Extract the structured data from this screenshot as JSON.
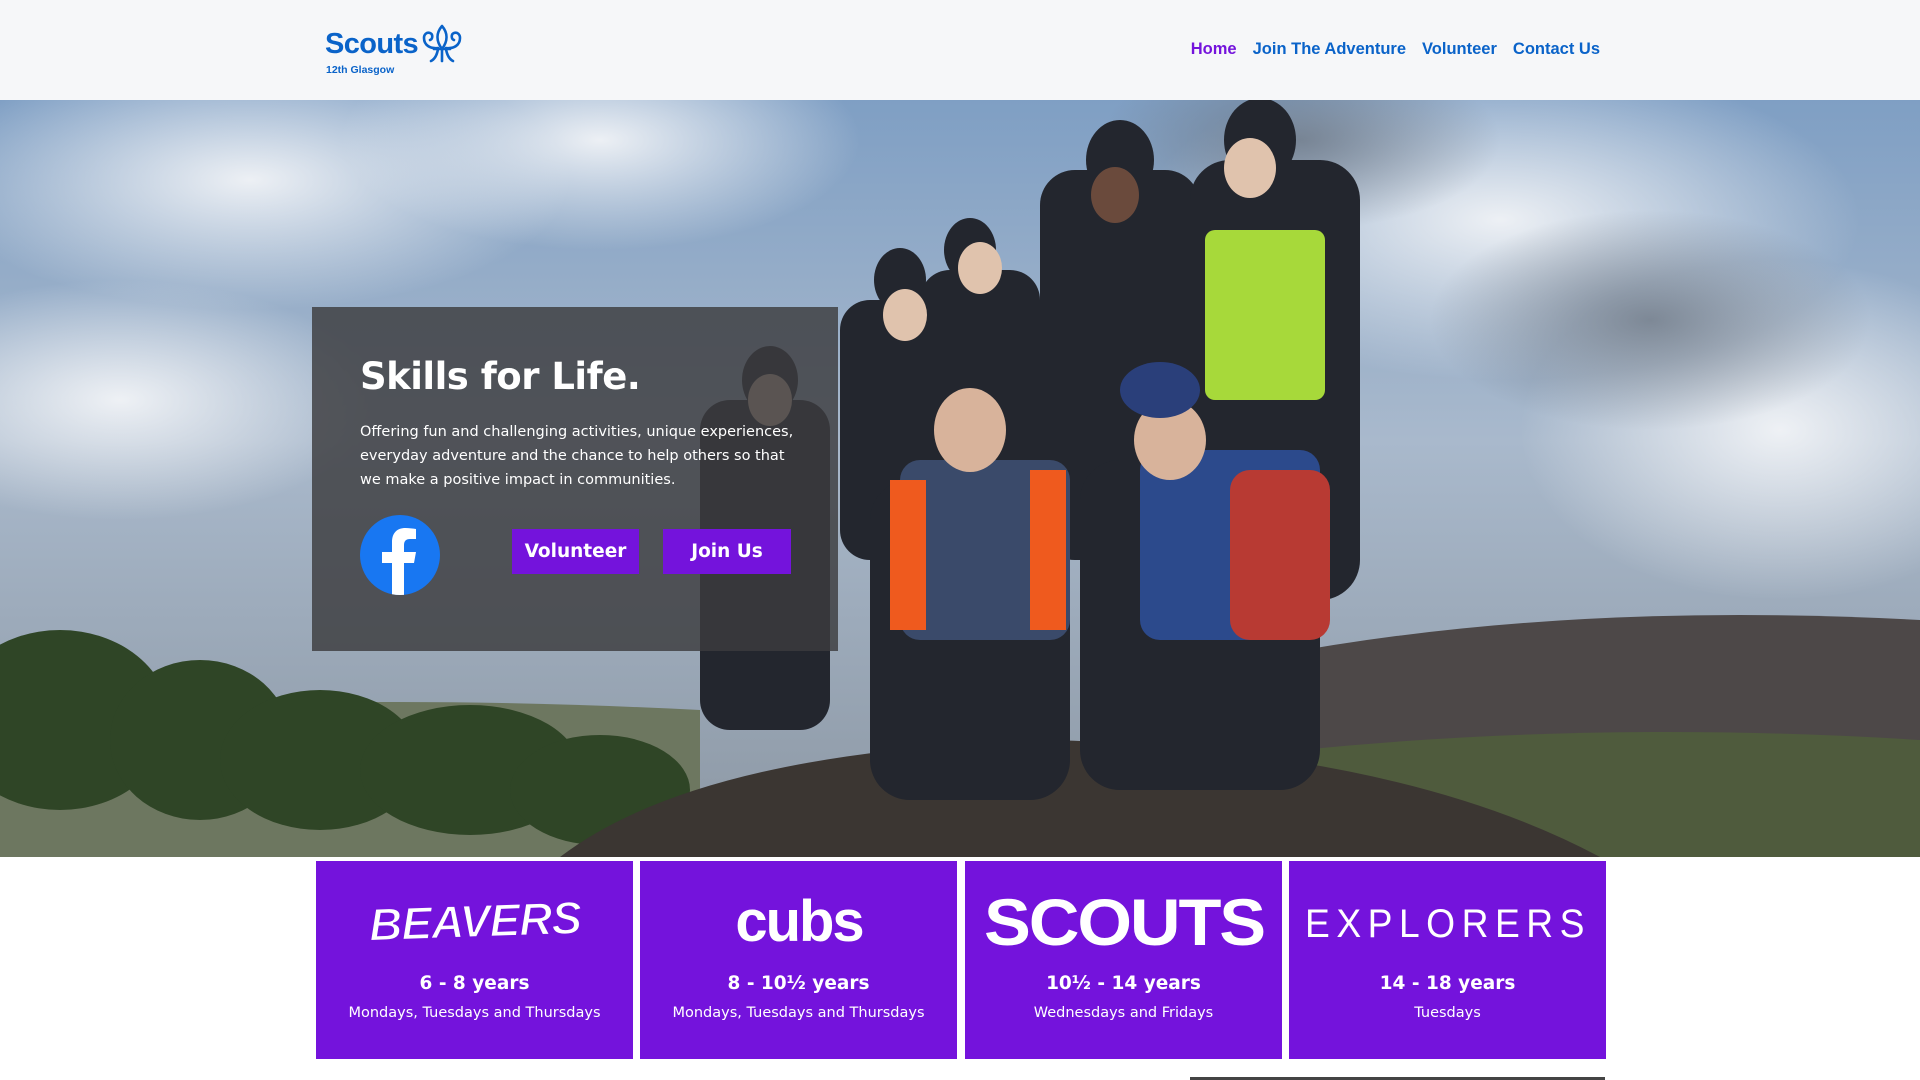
{
  "brand": {
    "name": "Scouts",
    "group": "12th Glasgow",
    "icon": "fleur-de-lis-icon",
    "color": "#0a63c9"
  },
  "nav": {
    "items": [
      {
        "label": "Home",
        "active": true
      },
      {
        "label": "Join The Adventure",
        "active": false
      },
      {
        "label": "Volunteer",
        "active": false
      },
      {
        "label": "Contact Us",
        "active": false
      }
    ],
    "active_color": "#7413dc"
  },
  "hero": {
    "title": "Skills for Life.",
    "text": "Offering fun and challenging activities, unique experiences, everyday adventure and the chance to help others so that we make a positive impact in communities.",
    "social_icon": "facebook-icon",
    "buttons": {
      "volunteer": "Volunteer",
      "join": "Join Us"
    }
  },
  "sections": [
    {
      "logo": "BEAVERS",
      "age": "6 - 8 years",
      "days": "Mondays, Tuesdays and Thursdays"
    },
    {
      "logo": "cubs",
      "age": "8 - 10½ years",
      "days": "Mondays, Tuesdays and Thursdays"
    },
    {
      "logo": "SCOUTS",
      "age": "10½ - 14 years",
      "days": "Wednesdays and Fridays"
    },
    {
      "logo": "EXPLORERS",
      "age": "14 - 18 years",
      "days": "Tuesdays"
    }
  ],
  "colors": {
    "accent": "#7413dc",
    "header_bg": "#f6f7f9",
    "facebook": "#1877f2"
  }
}
